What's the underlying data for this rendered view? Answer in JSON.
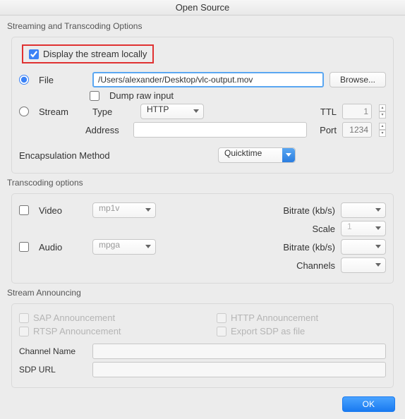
{
  "window": {
    "title": "Open Source"
  },
  "streaming": {
    "title": "Streaming and Transcoding Options",
    "display_locally": "Display the stream locally",
    "display_locally_checked": true,
    "file_label": "File",
    "file_path": "/Users/alexander/Desktop/vlc-output.mov",
    "browse": "Browse...",
    "dump_raw": "Dump raw input",
    "stream_label": "Stream",
    "type_label": "Type",
    "type_value": "HTTP",
    "ttl_label": "TTL",
    "ttl_value": "1",
    "address_label": "Address",
    "address_value": "",
    "port_label": "Port",
    "port_placeholder": "1234",
    "encaps_label": "Encapsulation Method",
    "encaps_value": "Quicktime"
  },
  "transcoding": {
    "title": "Transcoding options",
    "video_label": "Video",
    "video_codec": "mp1v",
    "bitrate_label": "Bitrate (kb/s)",
    "scale_label": "Scale",
    "scale_value": "1",
    "audio_label": "Audio",
    "audio_codec": "mpga",
    "channels_label": "Channels"
  },
  "announcing": {
    "title": "Stream Announcing",
    "sap": "SAP Announcement",
    "http": "HTTP Announcement",
    "rtsp": "RTSP Announcement",
    "sdp": "Export SDP as file",
    "channel_name": "Channel Name",
    "sdp_url": "SDP URL"
  },
  "footer": {
    "ok": "OK"
  }
}
